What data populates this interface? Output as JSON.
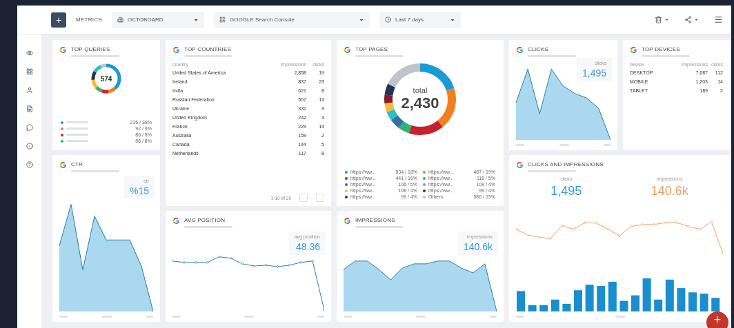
{
  "toolbar": {
    "add": "+",
    "metrics": "METRICS",
    "board": "OCTOBOARD",
    "source": "GOOGLE Search Console",
    "range": "Last 7 days"
  },
  "top_queries": {
    "title": "TOP QUERIES",
    "total": "574",
    "legend": [
      {
        "color": "#1a9ad6",
        "value": "216 / 38%"
      },
      {
        "color": "#f07f1e",
        "value": "92 / 9%"
      },
      {
        "color": "#d2232a",
        "value": "86 / 8%"
      },
      {
        "color": "#2bb673",
        "value": "86 / 8%"
      }
    ]
  },
  "top_countries": {
    "title": "TOP COUNTRIES",
    "columns": [
      "country",
      "impressions",
      "clicks"
    ],
    "rows": [
      [
        "United States of America",
        "2,858",
        "19"
      ],
      [
        "Ireland",
        "837",
        "23"
      ],
      [
        "India",
        "621",
        "8"
      ],
      [
        "Russian Federation",
        "557",
        "13"
      ],
      [
        "Ukraine",
        "331",
        "9"
      ],
      [
        "United Kingdom",
        "242",
        "4"
      ],
      [
        "France",
        "229",
        "14"
      ],
      [
        "Australia",
        "159",
        "2"
      ],
      [
        "Canada",
        "144",
        "5"
      ],
      [
        "Netherlands",
        "117",
        "8"
      ]
    ],
    "pager": "1-10 of 20"
  },
  "top_pages": {
    "title": "TOP PAGES",
    "total_label": "total",
    "total": "2,430",
    "legend": [
      {
        "color": "#1a9ad6",
        "label": "https://ww...",
        "value": "534 / 18%"
      },
      {
        "color": "#f07f1e",
        "label": "https://ww...",
        "value": "487 / 19%"
      },
      {
        "color": "#c8202d",
        "label": "https://ww...",
        "value": "441 / 16%"
      },
      {
        "color": "#2bb673",
        "label": "https://ww...",
        "value": "118 / 5%"
      },
      {
        "color": "#3a6ea5",
        "label": "https://ww...",
        "value": "106 / 5%"
      },
      {
        "color": "#26c1c9",
        "label": "https://ww...",
        "value": "109 / 4%"
      },
      {
        "color": "#f6b93b",
        "label": "https://ww...",
        "value": "108 / 4%"
      },
      {
        "color": "#8b1a2b",
        "label": "https://ww...",
        "value": "99 / 4%"
      },
      {
        "color": "#1d3557",
        "label": "https://ww...",
        "value": "99 / 4%"
      },
      {
        "color": "#c0c4c8",
        "label": "Others",
        "value": "586 / 15%"
      }
    ]
  },
  "clicks": {
    "title": "CLICKS",
    "badge_label": "clicks",
    "value": "1,495"
  },
  "top_devices": {
    "title": "TOP DEVICES",
    "columns": [
      "device",
      "impressions",
      "clicks"
    ],
    "rows": [
      [
        "DESKTOP",
        "7,687",
        "112"
      ],
      [
        "MOBILE",
        "1,203",
        "14"
      ],
      [
        "TABLET",
        "189",
        "2"
      ]
    ]
  },
  "ctr": {
    "title": "CTR",
    "badge_label": "ctr",
    "value": "%15"
  },
  "avg_position": {
    "title": "AVG POSITION",
    "badge_label": "avg position",
    "value": "48.36"
  },
  "impressions": {
    "title": "IMPRESSIONS",
    "badge_label": "impressions",
    "value": "140.6k"
  },
  "clicks_and_impressions": {
    "title": "CLICKS AND IMPRESSIONS",
    "metrics": [
      {
        "label": "clicks",
        "value": "1,495",
        "color": "#3a9bd5"
      },
      {
        "label": "impressions",
        "value": "140.6k",
        "color": "#f0a060"
      }
    ]
  },
  "fab": "+"
}
